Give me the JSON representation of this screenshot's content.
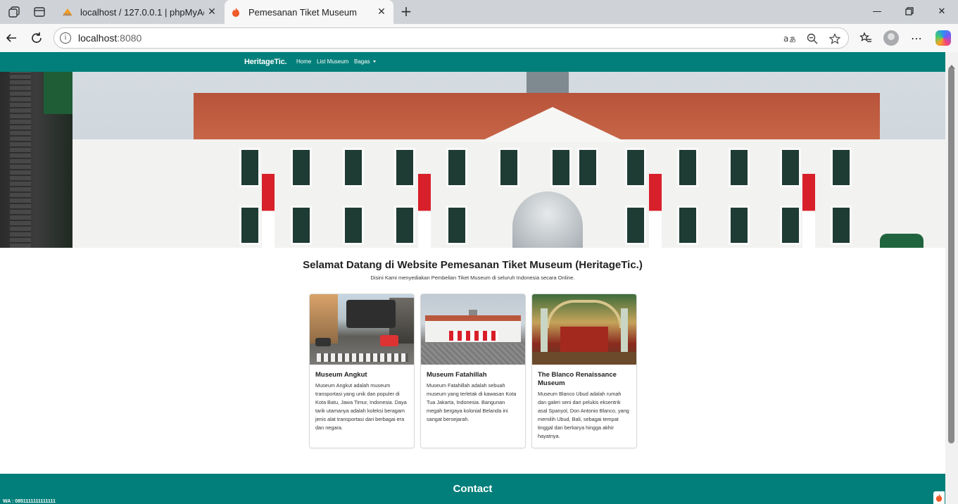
{
  "browser": {
    "tabs": [
      {
        "title": "localhost / 127.0.0.1 | phpMyAdmin",
        "favicon": "phpmyadmin-icon",
        "active": false
      },
      {
        "title": "Pemesanan Tiket Museum",
        "favicon": "flame-icon",
        "active": true
      }
    ],
    "url_host": "localhost",
    "url_port": ":8080"
  },
  "site": {
    "brand": "HeritageTic.",
    "nav": {
      "home": "Home",
      "list_museum": "List Museum",
      "bagas": "Bagas"
    },
    "welcome_title": "Selamat Datang di Website Pemesanan Tiket Museum (HeritageTic.)",
    "welcome_subtitle": "Disini Kami menyediakan Pembelian Tiket Museum di seluruh Indonesia secara Online.",
    "cards": [
      {
        "name": "Museum Angkut",
        "description": "Museum Angkut adalah museum transportasi yang unik dan populer di Kota Batu, Jawa Timur, Indonesia. Daya tarik utamanya adalah koleksi beragam jenis alat transportasi dari berbagai era dan negara."
      },
      {
        "name": "Museum Fatahillah",
        "description": "Museum Fatahillah adalah sebuah museum yang terletak di kawasan Kota Tua Jakarta, Indonesia. Bangunan megah bergaya kolonial Belanda ini sangat bersejarah."
      },
      {
        "name": "The Blanco Renaissance Museum",
        "description": "Museum Blanco Ubud adalah rumah dan galeri seni dari pelukis eksentrik asal Spanyol, Don Antonio Blanco, yang memilih Ubud, Bali, sebagai tempat tinggal dan berkarya hingga akhir hayatnya."
      }
    ],
    "footer": {
      "contact_title": "Contact",
      "wa": "WA : 0851111111111111"
    }
  },
  "colors": {
    "primary": "#027f7a"
  }
}
